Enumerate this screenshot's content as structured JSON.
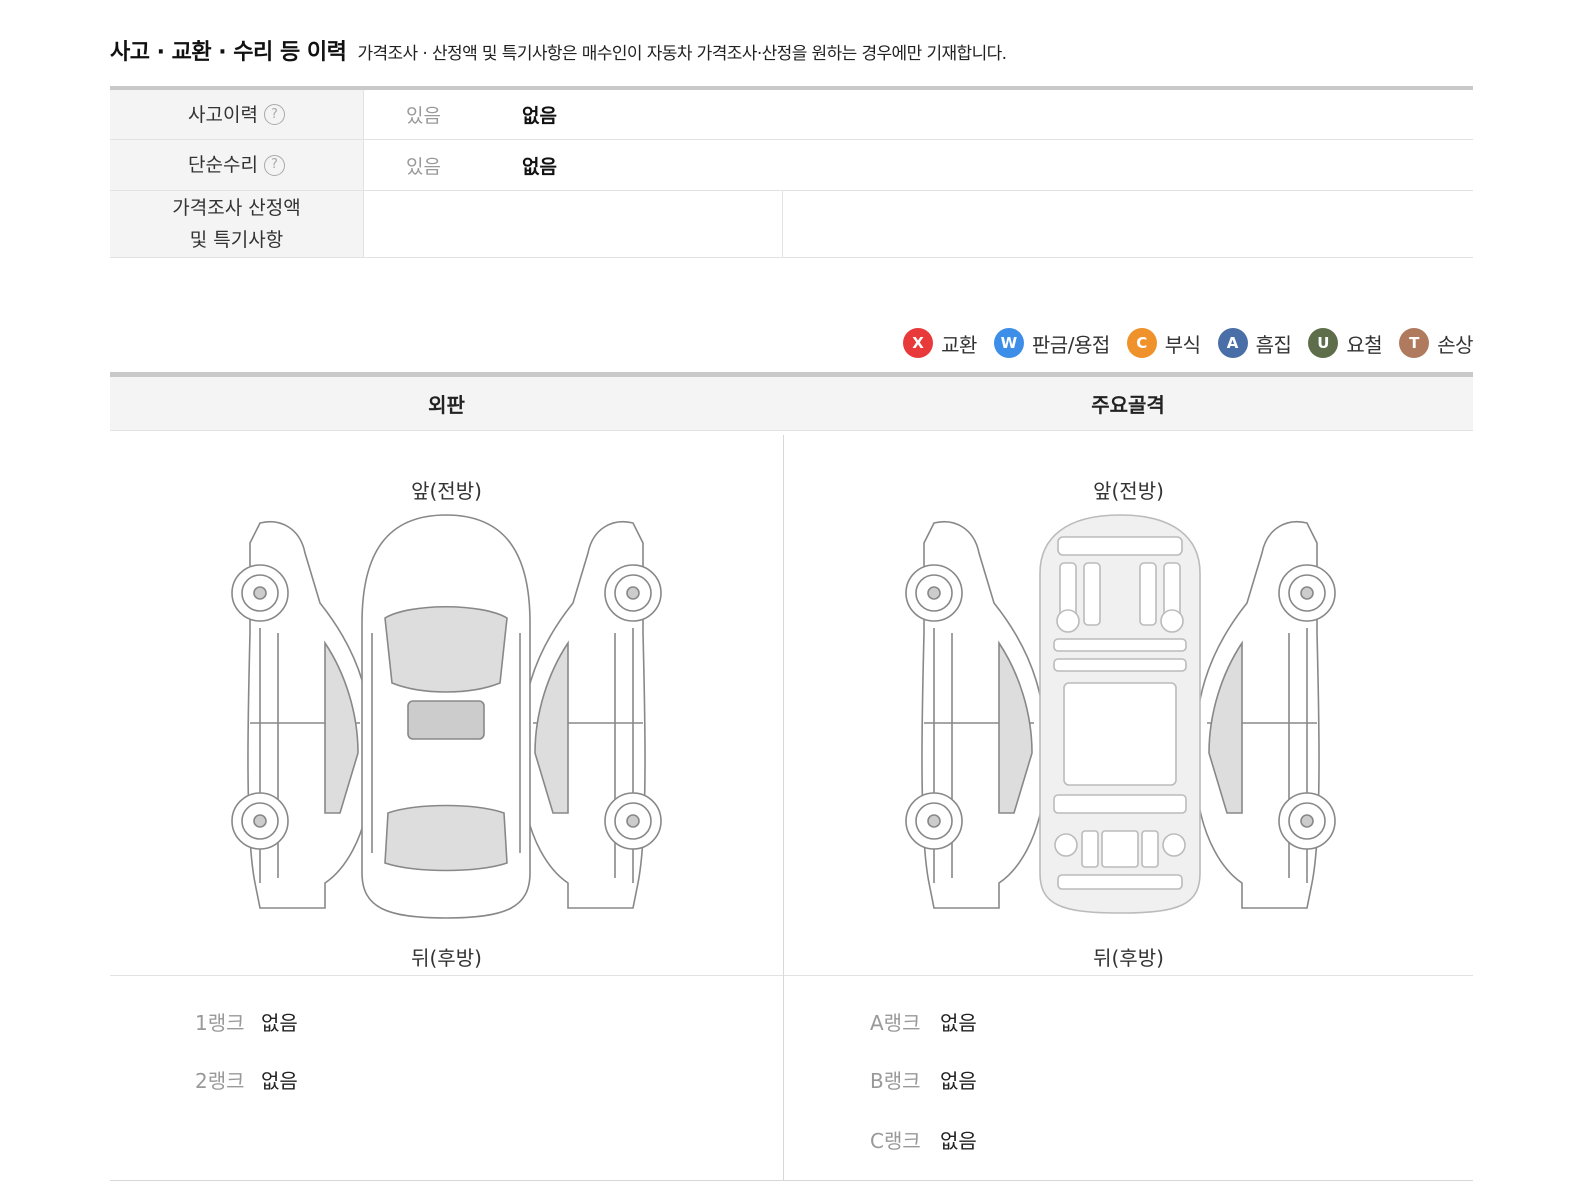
{
  "heading": {
    "title": "사고 · 교환 · 수리 등 이력",
    "note": "가격조사 · 산정액 및 특기사항은 매수인이 자동차 가격조사·산정을 원하는 경우에만 기재합니다."
  },
  "history": {
    "rows": [
      {
        "label": "사고이력",
        "off": "있음",
        "on": "없음"
      },
      {
        "label": "단순수리",
        "off": "있음",
        "on": "없음"
      }
    ],
    "price_label_line1": "가격조사 산정액",
    "price_label_line2": "및 특기사항",
    "help_glyph": "?"
  },
  "legend": [
    {
      "letter": "X",
      "label": "교환",
      "color": "#e83a3a"
    },
    {
      "letter": "W",
      "label": "판금/용접",
      "color": "#3d8ee8"
    },
    {
      "letter": "C",
      "label": "부식",
      "color": "#f0922b"
    },
    {
      "letter": "A",
      "label": "흠집",
      "color": "#4a6fa8"
    },
    {
      "letter": "U",
      "label": "요철",
      "color": "#5e6e4a"
    },
    {
      "letter": "T",
      "label": "손상",
      "color": "#b07a5e"
    }
  ],
  "panel": {
    "left_title": "외판",
    "right_title": "주요골격",
    "front": "앞(전방)",
    "rear": "뒤(후방)"
  },
  "ranks_left": [
    {
      "label": "1랭크",
      "value": "없음"
    },
    {
      "label": "2랭크",
      "value": "없음"
    }
  ],
  "ranks_right": [
    {
      "label": "A랭크",
      "value": "없음"
    },
    {
      "label": "B랭크",
      "value": "없음"
    },
    {
      "label": "C랭크",
      "value": "없음"
    }
  ]
}
